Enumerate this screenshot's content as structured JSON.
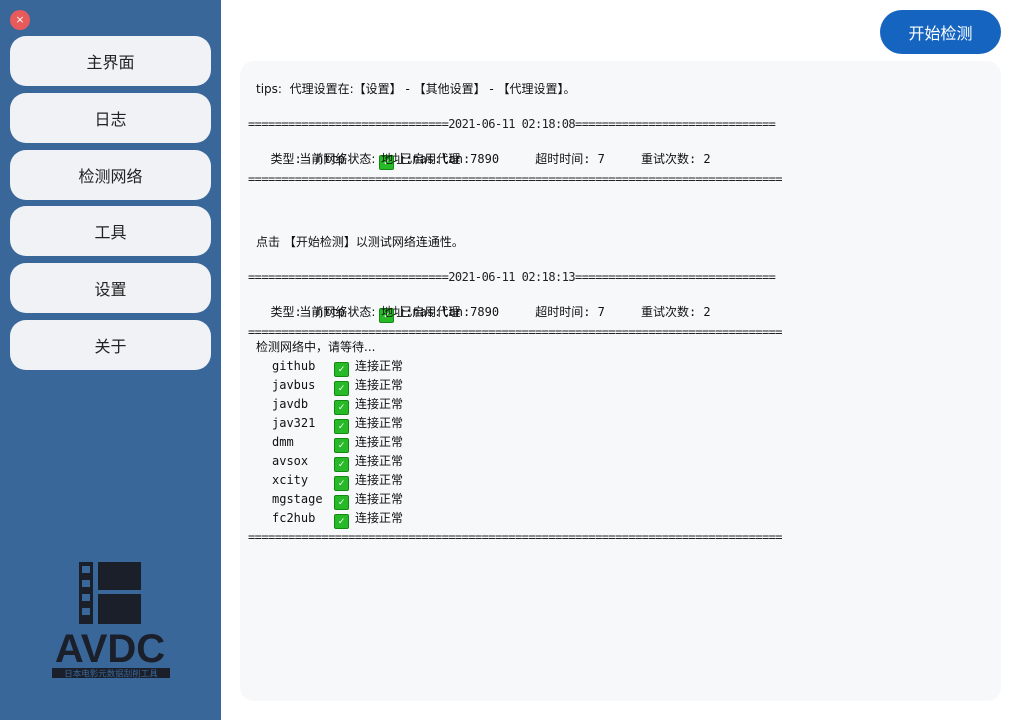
{
  "sidebar": {
    "close_icon": "×",
    "items": [
      {
        "label": "主界面"
      },
      {
        "label": "日志"
      },
      {
        "label": "检测网络"
      },
      {
        "label": "工具"
      },
      {
        "label": "设置"
      },
      {
        "label": "关于"
      }
    ],
    "logo": {
      "text": "AVDC",
      "subtitle": "日本电影元数据刮削工具"
    }
  },
  "main": {
    "start_button": "开始检测",
    "log": {
      "tips": "tips:  代理设置在:【设置】 - 【其他设置】 - 【代理设置】。",
      "sep_line": "================================================================================",
      "block1": {
        "header": "==============================2021-06-11 02:18:08==============================",
        "status_label": "当前网络状态:",
        "status_value": "已启用代理",
        "details": "  类型:  http     地址:nas.lan:7890     超时时间: 7     重试次数: 2"
      },
      "hint": "点击 【开始检测】以测试网络连通性。",
      "block2": {
        "header": "==============================2021-06-11 02:18:13==============================",
        "status_label": "当前网络状态:",
        "status_value": "已启用代理",
        "details": "  类型:  http     地址:nas.lan:7890     超时时间: 7     重试次数: 2",
        "checking": "检测网络中，请等待...",
        "sites": [
          {
            "name": "github",
            "status": "连接正常"
          },
          {
            "name": "javbus",
            "status": "连接正常"
          },
          {
            "name": "javdb",
            "status": "连接正常"
          },
          {
            "name": "jav321",
            "status": "连接正常"
          },
          {
            "name": "dmm",
            "status": "连接正常"
          },
          {
            "name": "avsox",
            "status": "连接正常"
          },
          {
            "name": "xcity",
            "status": "连接正常"
          },
          {
            "name": "mgstage",
            "status": "连接正常"
          },
          {
            "name": "fc2hub",
            "status": "连接正常"
          }
        ]
      }
    }
  },
  "colors": {
    "sidebar": "#3a6799",
    "button": "#1565c0",
    "check": "#28b928",
    "close": "#e95a5a"
  }
}
